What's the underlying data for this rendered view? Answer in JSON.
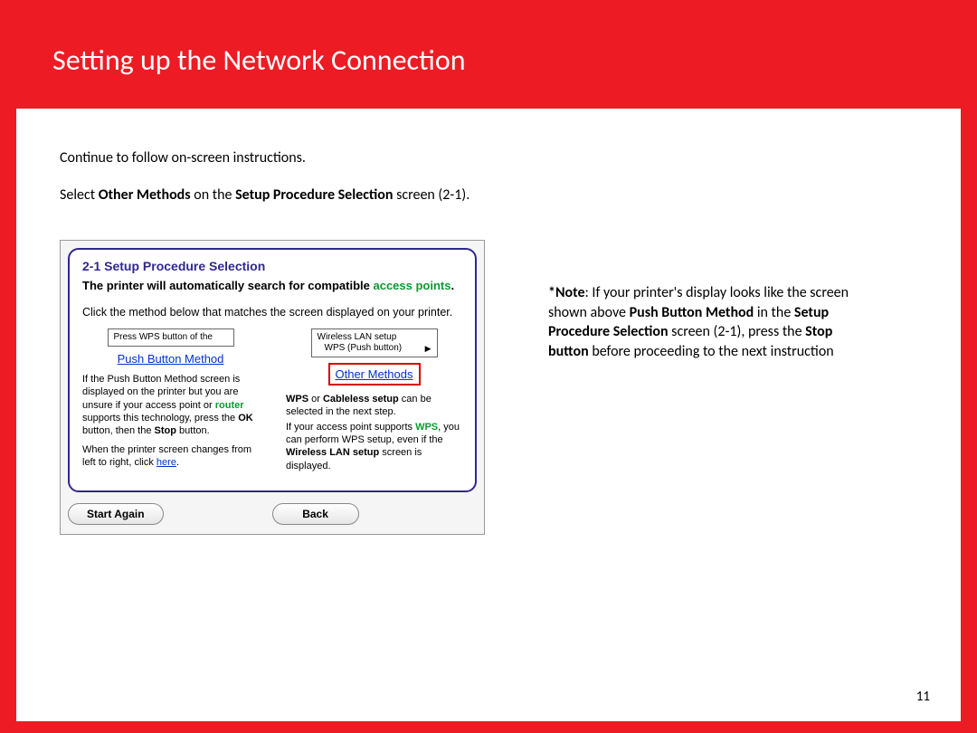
{
  "title": "Setting up the Network Connection",
  "para1": "Continue to follow on-screen instructions.",
  "para2": {
    "pre": "Select ",
    "b1": "Other Methods",
    "mid": " on the ",
    "b2": "Setup Procedure Selection",
    "post": " screen (2-1)."
  },
  "panel": {
    "heading": "2-1 Setup Procedure Selection",
    "sub_pre": "The printer will automatically search for compatible ",
    "sub_green": "access points",
    "sub_post": ".",
    "text": "Click the method below that matches the screen displayed on your printer.",
    "left": {
      "lcd": "Press WPS button of the",
      "link": "Push Button Method",
      "desc_1": "If the Push Button Method screen is displayed on the printer but you are unsure if your access point or ",
      "desc_green": "router",
      "desc_2": " supports this technology, press the ",
      "desc_b1": "OK",
      "desc_3": " button, then the ",
      "desc_b2": "Stop",
      "desc_4": " button.",
      "desc_5": "When the printer screen changes from left to right, click ",
      "desc_link": "here",
      "desc_6": "."
    },
    "right": {
      "lcd_l1": "Wireless LAN setup",
      "lcd_l2": "WPS (Push button)",
      "link": "Other Methods",
      "desc_b1": "WPS",
      "desc_1": " or ",
      "desc_b2": "Cableless setup",
      "desc_2": " can be selected in the next step.",
      "desc_3": "If your access point supports ",
      "desc_green": "WPS",
      "desc_4": ", you can perform WPS setup, even if the ",
      "desc_b3": "Wireless LAN setup",
      "desc_5": " screen is displayed."
    },
    "btn_start": "Start Again",
    "btn_back": "Back"
  },
  "note": {
    "b1": "*Note",
    "t1": ":  If your printer's display looks like the screen shown above ",
    "b2": "Push Button Method",
    "t2": " in the ",
    "b3": "Setup Procedure Selection",
    "t3": " screen (2-1), press the ",
    "b4": "Stop button",
    "t4": " before proceeding to the next instruction"
  },
  "page": "11"
}
